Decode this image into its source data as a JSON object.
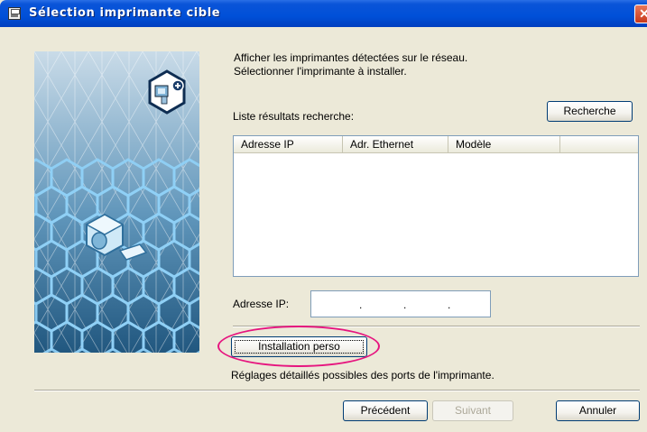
{
  "window": {
    "title": "Sélection imprimante cible"
  },
  "instructions": {
    "line1": "Afficher les imprimantes détectées sur le réseau.",
    "line2": "Sélectionner l'imprimante à installer."
  },
  "search": {
    "label": "Liste résultats recherche:",
    "button": "Recherche"
  },
  "results_table": {
    "columns": [
      "Adresse IP",
      "Adr. Ethernet",
      "Modèle",
      ""
    ],
    "rows": []
  },
  "ip_field": {
    "label": "Adresse IP:",
    "value": "",
    "separators": [
      ".",
      ".",
      "."
    ]
  },
  "custom_install": {
    "button": "Installation perso",
    "description": "Réglages détaillés possibles des ports de l'imprimante."
  },
  "footer": {
    "prev": "Précédent",
    "next": "Suivant",
    "cancel": "Annuler"
  },
  "colors": {
    "titlebar": "#0050d8",
    "dialog_bg": "#ece9d8",
    "highlight": "#e6157f"
  }
}
